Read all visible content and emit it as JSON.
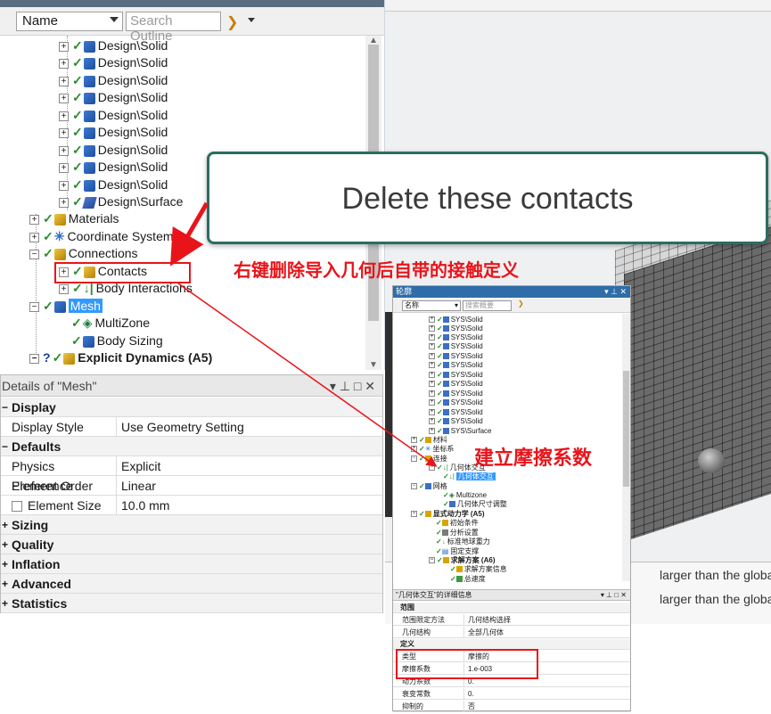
{
  "outline": {
    "name_select": "Name",
    "search_placeholder": "Search Outline",
    "tree": {
      "solids": [
        "Design\\Solid",
        "Design\\Solid",
        "Design\\Solid",
        "Design\\Solid",
        "Design\\Solid",
        "Design\\Solid",
        "Design\\Solid",
        "Design\\Solid",
        "Design\\Solid"
      ],
      "surface": "Design\\Surface",
      "materials": "Materials",
      "coordinate_systems": "Coordinate Systems",
      "connections": "Connections",
      "contacts": "Contacts",
      "body_interactions": "Body Interactions",
      "mesh": "Mesh",
      "multizone": "MultiZone",
      "body_sizing": "Body Sizing",
      "explicit_dynamics": "Explicit Dynamics (A5)"
    }
  },
  "details": {
    "title": "Details of \"Mesh\"",
    "controls": "▾ ⊥ □ ✕",
    "sections": {
      "display": "Display",
      "defaults": "Defaults",
      "sizing": "Sizing",
      "quality": "Quality",
      "inflation": "Inflation",
      "advanced": "Advanced",
      "statistics": "Statistics"
    },
    "props": {
      "display_style_k": "Display Style",
      "display_style_v": "Use Geometry Setting",
      "physics_pref_k": "Physics Preference",
      "physics_pref_v": "Explicit",
      "element_order_k": "Element Order",
      "element_order_v": "Linear",
      "element_size_k": "Element Size",
      "element_size_v": "10.0 mm"
    }
  },
  "callout": {
    "text": "Delete these contacts"
  },
  "annotations": {
    "red_1": "右键删除导入几何后自带的接触定义",
    "red_2": "建立摩擦系数"
  },
  "viewport": {
    "msg_1": "larger than the global m",
    "msg_2": "larger than the global m"
  },
  "cn_window": {
    "title": "轮廓",
    "controls": "▾ ⊥ ✕",
    "name_select": "名称",
    "search_placeholder": "搜索概要",
    "tree": {
      "solids": [
        "SYS\\Solid",
        "SYS\\Solid",
        "SYS\\Solid",
        "SYS\\Solid",
        "SYS\\Solid",
        "SYS\\Solid",
        "SYS\\Solid",
        "SYS\\Solid",
        "SYS\\Solid",
        "SYS\\Solid",
        "SYS\\Solid",
        "SYS\\Solid"
      ],
      "surface": "SYS\\Surface",
      "materials": "材料",
      "coord": "坐标系",
      "connections": "连接",
      "geom_interaction_group": "几何体交互",
      "geom_interaction": "几何体交互",
      "mesh": "网格",
      "multizone": "Multizone",
      "body_sizing": "几何体尺寸调整",
      "explicit_dynamics": "显式动力学 (A5)",
      "initial_conditions": "初始条件",
      "analysis_settings": "分析设置",
      "standard_gravity": "标准地球重力",
      "fixed_support": "固定支撑",
      "solution": "求解方案 (A6)",
      "solution_info": "求解方案信息",
      "total_velocity": "总速度"
    },
    "details_title": "\"几何体交互\"的详细信息",
    "details_controls": "▾ ⊥ □ ✕",
    "details": {
      "scope": "范围",
      "scoping_method_k": "范围限定方法",
      "scoping_method_v": "几何结构选择",
      "geometry_k": "几何结构",
      "geometry_v": "全部几何体",
      "definition": "定义",
      "type_k": "类型",
      "type_v": "摩擦的",
      "friction_k": "摩擦系数",
      "friction_v": "1.e-003",
      "dynamic_k": "动力系数",
      "dynamic_v": "0.",
      "decay_k": "衰变常数",
      "decay_v": "0.",
      "suppressed_k": "抑制的",
      "suppressed_v": "否"
    }
  },
  "colors": {
    "accent_red": "#e8141a",
    "selection_blue": "#3399ff",
    "callout_border": "#2c6d5f"
  }
}
